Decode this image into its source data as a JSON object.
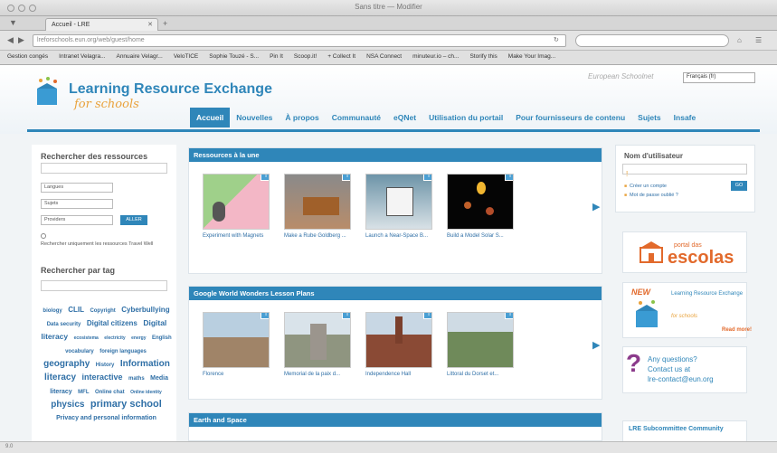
{
  "browser": {
    "window_title": "Sans titre — Modifier",
    "tab_title": "Accueil - LRE",
    "url": "lreforschools.eun.org/web/guest/home",
    "bookmarks": [
      "Gestion congés",
      "Intranet Velagra...",
      "Annuaire Velagr...",
      "VeloTICE",
      "Sophie Touzé - S...",
      "Pin It",
      "Scoop.it!",
      "+ Collect It",
      "NSA Connect",
      "minuteur.io – ch...",
      "Storify this",
      "Make Your Imag..."
    ],
    "status_text": "9.0"
  },
  "site": {
    "title": "Learning Resource Exchange",
    "subtitle": "for schools",
    "eschool_badge": "European Schoolnet",
    "language_select": "Français (fr)",
    "nav": [
      "Accueil",
      "Nouvelles",
      "À propos",
      "Communauté",
      "eQNet",
      "Utilisation du portail",
      "Pour fournisseurs de contenu",
      "Sujets",
      "Insafe"
    ]
  },
  "left": {
    "search_title": "Rechercher des ressources",
    "selects": [
      "Langues",
      "Sujets",
      "Providers"
    ],
    "go_label": "ALLER",
    "travel_well_label": "Rechercher uniquement les ressources Travel Well",
    "tag_title": "Rechercher par tag",
    "tags": [
      {
        "text": "biology",
        "size": 6
      },
      {
        "text": "CLIL",
        "size": 8
      },
      {
        "text": "Copyright",
        "size": 6
      },
      {
        "text": "Cyberbullying",
        "size": 8
      },
      {
        "text": "Data security",
        "size": 6
      },
      {
        "text": "Digital citizens",
        "size": 8
      },
      {
        "text": "Digital literacy",
        "size": 8.5
      },
      {
        "text": "ecosistema",
        "size": 5
      },
      {
        "text": "electricity",
        "size": 5
      },
      {
        "text": "energy",
        "size": 5
      },
      {
        "text": "English vocabulary",
        "size": 6
      },
      {
        "text": "foreign languages",
        "size": 6
      },
      {
        "text": "geography",
        "size": 10
      },
      {
        "text": "History",
        "size": 6
      },
      {
        "text": "Information literacy",
        "size": 10
      },
      {
        "text": "interactive",
        "size": 9
      },
      {
        "text": "maths",
        "size": 6
      },
      {
        "text": "Media literacy",
        "size": 7
      },
      {
        "text": "MFL",
        "size": 6
      },
      {
        "text": "Online chat",
        "size": 6
      },
      {
        "text": "Online identity",
        "size": 5
      },
      {
        "text": "physics",
        "size": 10
      },
      {
        "text": "primary school",
        "size": 11
      },
      {
        "text": "Privacy and personal information",
        "size": 7
      }
    ]
  },
  "sections": [
    {
      "title": "Ressources à la une",
      "items": [
        "Experiment with Magnets",
        "Make a Rube Goldberg ...",
        "Launch a Near-Space B...",
        "Build a Model Solar S..."
      ]
    },
    {
      "title": "Google World Wonders Lesson Plans",
      "items": [
        "Florence",
        "Memorial de la paix d...",
        "Independence Hall",
        "Littoral du Dorset et..."
      ]
    },
    {
      "title": "Earth and Space",
      "items": []
    }
  ],
  "badge_label": "i",
  "right": {
    "login_title": "Nom d'utilisateur",
    "login_cursor": "!",
    "links": [
      "Créer un compte",
      "Mot de passe oublié ?"
    ],
    "login_btn": "GO",
    "escolas_small": "portal das",
    "escolas_big": "escolas",
    "lre_promo": "Learning Resource Exchange",
    "lre_promo_sub": "for schools",
    "new_label": "NEW",
    "read_more": "Read more!",
    "contact_lines": [
      "Any questions?",
      "Contact us at",
      "lre-contact@eun.org"
    ],
    "community": "LRE Subcommittee Community"
  },
  "colors": {
    "accent": "#2f86b9",
    "orange": "#e9a23b"
  }
}
